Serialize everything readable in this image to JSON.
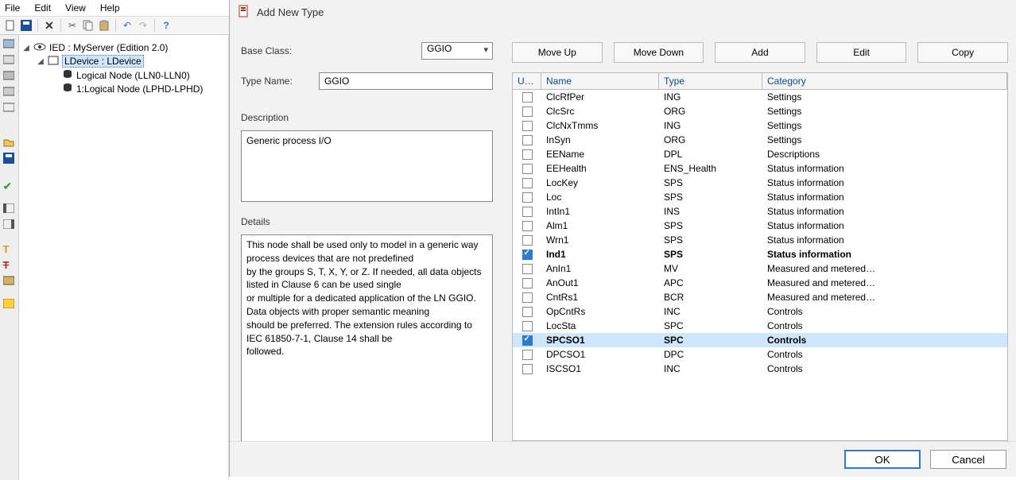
{
  "menu": {
    "file": "File",
    "edit": "Edit",
    "view": "View",
    "help": "Help"
  },
  "tree": {
    "root": "IED : MyServer (Edition 2.0)",
    "ldevice": "LDevice : LDevice",
    "node1": "Logical Node (LLN0-LLN0)",
    "node2": "1:Logical Node (LPHD-LPHD)"
  },
  "dialog": {
    "title": "Add New Type",
    "base_class_label": "Base Class:",
    "base_class_value": "GGIO",
    "type_name_label": "Type Name:",
    "type_name_value": "GGIO",
    "description_label": "Description",
    "description_value": "Generic process I/O",
    "details_label": "Details",
    "details_value": "This node shall be used only to model in a generic way process devices that are not predefined\nby the groups S, T, X, Y, or Z. If needed, all data objects listed in Clause 6 can be used single\nor multiple for a dedicated application of the LN GGIO. Data objects with proper semantic meaning\nshould be preferred. The extension rules according to IEC 61850-7-1, Clause 14 shall be\nfollowed.",
    "buttons": {
      "move_up": "Move Up",
      "move_down": "Move Down",
      "add": "Add",
      "edit": "Edit",
      "copy": "Copy"
    },
    "headers": {
      "use": "U…",
      "name": "Name",
      "type": "Type",
      "category": "Category"
    },
    "rows": [
      {
        "checked": false,
        "name": "ClcRfPer",
        "type": "ING",
        "category": "Settings"
      },
      {
        "checked": false,
        "name": "ClcSrc",
        "type": "ORG",
        "category": "Settings"
      },
      {
        "checked": false,
        "name": "ClcNxTmms",
        "type": "ING",
        "category": "Settings"
      },
      {
        "checked": false,
        "name": "InSyn",
        "type": "ORG",
        "category": "Settings"
      },
      {
        "checked": false,
        "name": "EEName",
        "type": "DPL",
        "category": "Descriptions"
      },
      {
        "checked": false,
        "name": "EEHealth",
        "type": "ENS_Health",
        "category": "Status information"
      },
      {
        "checked": false,
        "name": "LocKey",
        "type": "SPS",
        "category": "Status information"
      },
      {
        "checked": false,
        "name": "Loc",
        "type": "SPS",
        "category": "Status information"
      },
      {
        "checked": false,
        "name": "IntIn1",
        "type": "INS",
        "category": "Status information"
      },
      {
        "checked": false,
        "name": "Alm1",
        "type": "SPS",
        "category": "Status information"
      },
      {
        "checked": false,
        "name": "Wrn1",
        "type": "SPS",
        "category": "Status information"
      },
      {
        "checked": true,
        "name": "Ind1",
        "type": "SPS",
        "category": "Status information"
      },
      {
        "checked": false,
        "name": "AnIn1",
        "type": "MV",
        "category": "Measured and metered…"
      },
      {
        "checked": false,
        "name": "AnOut1",
        "type": "APC",
        "category": "Measured and metered…"
      },
      {
        "checked": false,
        "name": "CntRs1",
        "type": "BCR",
        "category": "Measured and metered…"
      },
      {
        "checked": false,
        "name": "OpCntRs",
        "type": "INC",
        "category": "Controls"
      },
      {
        "checked": false,
        "name": "LocSta",
        "type": "SPC",
        "category": "Controls"
      },
      {
        "checked": true,
        "name": "SPCSO1",
        "type": "SPC",
        "category": "Controls",
        "selected": true
      },
      {
        "checked": false,
        "name": "DPCSO1",
        "type": "DPC",
        "category": "Controls"
      },
      {
        "checked": false,
        "name": "ISCSO1",
        "type": "INC",
        "category": "Controls"
      }
    ],
    "ok": "OK",
    "cancel": "Cancel"
  }
}
